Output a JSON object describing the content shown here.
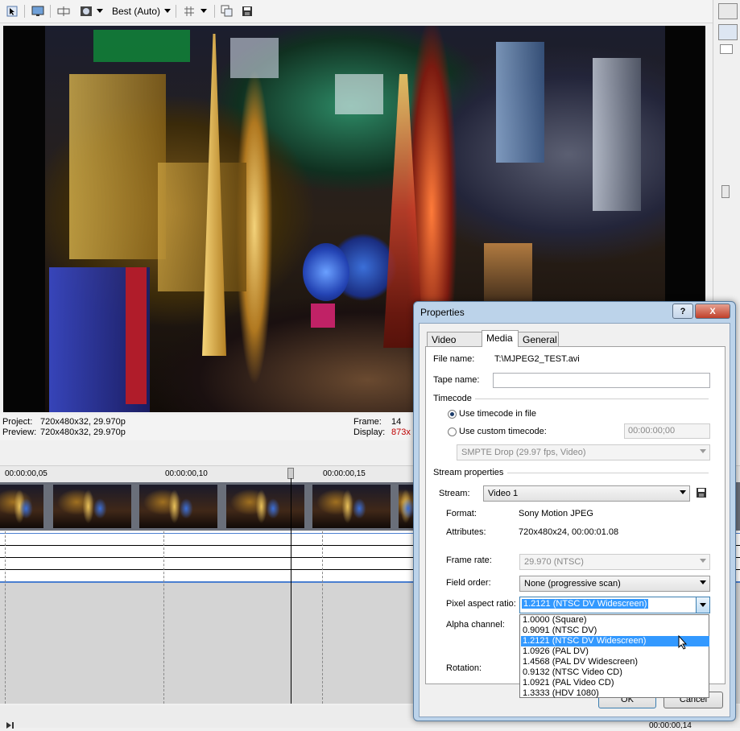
{
  "toolbar": {
    "quality_label": "Best (Auto)"
  },
  "status": {
    "project_label": "Project:",
    "project_value": "720x480x32, 29.970p",
    "preview_label": "Preview:",
    "preview_value": "720x480x32, 29.970p",
    "frame_label": "Frame:",
    "frame_value": "14",
    "display_label": "Display:",
    "display_value": "873x"
  },
  "timeline": {
    "ticks": [
      "00:00:00,05",
      "00:00:00,10",
      "00:00:00,15"
    ],
    "bottom_time": "00:00:00,14"
  },
  "dialog": {
    "title": "Properties",
    "help_label": "?",
    "close_label": "X",
    "tabs": [
      "Video Event",
      "Media",
      "General"
    ],
    "active_tab": "Media",
    "file_name_label": "File name:",
    "file_name_value": "T:\\MJPEG2_TEST.avi",
    "tape_name_label": "Tape name:",
    "tape_name_value": "",
    "timecode_group": "Timecode",
    "use_timecode_label": "Use timecode in file",
    "use_custom_label": "Use custom timecode:",
    "custom_timecode_value": "00:00:00;00",
    "timecode_format": "SMPTE Drop (29.97 fps, Video)",
    "stream_group": "Stream properties",
    "stream_label": "Stream:",
    "stream_value": "Video 1",
    "format_label": "Format:",
    "format_value": "Sony Motion JPEG",
    "attributes_label": "Attributes:",
    "attributes_value": "720x480x24, 00:00:01.08",
    "frame_rate_label": "Frame rate:",
    "frame_rate_value": "29.970 (NTSC)",
    "field_order_label": "Field order:",
    "field_order_value": "None (progressive scan)",
    "par_label": "Pixel aspect ratio:",
    "par_value": "1.2121 (NTSC DV Widescreen)",
    "alpha_label": "Alpha channel:",
    "rotation_label": "Rotation:",
    "ok_label": "OK",
    "cancel_label": "Cancel",
    "par_options": [
      "1.0000 (Square)",
      "0.9091 (NTSC DV)",
      "1.2121 (NTSC DV Widescreen)",
      "1.0926 (PAL DV)",
      "1.4568 (PAL DV Widescreen)",
      "0.9132 (NTSC Video CD)",
      "1.0921 (PAL Video CD)",
      "1.3333 (HDV 1080)"
    ],
    "par_selected_index": 2
  },
  "colors": {
    "selection": "#3399ff",
    "display_value": "#c00000",
    "dialog_frame": "#bcd3ea"
  }
}
